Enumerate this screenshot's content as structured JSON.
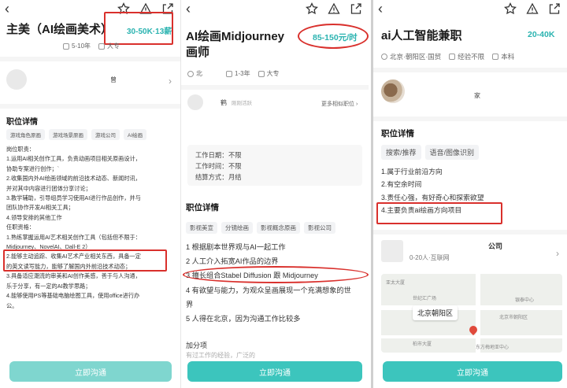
{
  "colors": {
    "accent": "#3cc5bd",
    "salary": "#2ab3b0",
    "annotation": "#d9302c"
  },
  "icons": {
    "back": "chevron-left-icon",
    "star": "star-icon",
    "warning": "warning-icon",
    "share": "share-icon"
  },
  "panel1": {
    "title": "主美（AI绘画美术）",
    "salary": "30-50K·13薪",
    "meta": {
      "exp": "5-10年",
      "edu": "大专"
    },
    "hr_name": "曾",
    "section_title": "职位详情",
    "tags": [
      "游戏角色原画",
      "游戏场景原画",
      "游戏公司",
      "AI绘画"
    ],
    "desc_lines": [
      "岗位职责：",
      "1.运用AI相关创作工具，负责动画项目相关原画设计，",
      "协助专案进行创作；`",
      "2.收集国内外AI绘画领域的前沿技术动态、新闻时讯，",
      "并对其中内容进行团体分享讨论；",
      "3.教学辅助，引导组员学习使用AI进行作品创作，并与",
      "团队协作开发AI相关工具；",
      "4.领导安排的其他工作",
      "任职资格：",
      "1.熟练掌握运用AI艺术相关创作工具（包括但不限于：",
      "Midjourney、NovelAI、Dall-E 2）",
      "2.能够主动追踪、收集AI艺术产业相关东西，具备一定",
      "的英文读写能力，能够了解国内外前沿技术动态；",
      "3.具备适应潮流的审美和AI创作美感，善于与人沟通，",
      "乐于分享，有一定的AI教学思路；",
      "4.能够使用PS等基础电脑绘图工具，使用office进行办",
      "公。"
    ],
    "cta": "立即沟通"
  },
  "panel2": {
    "title_line1": "AI绘画Midjourney",
    "title_line2": "画师",
    "salary": "85-150元/时",
    "meta": {
      "city": "北",
      "exp": "1-3年",
      "edu": "大专"
    },
    "hr_name": "鹤",
    "hr_status": "刚刚活跃",
    "more_link": "更多相似职位 ›",
    "info": [
      {
        "label": "工作日期：",
        "value": "不限"
      },
      {
        "label": "工作时间：",
        "value": "不限"
      },
      {
        "label": "结算方式：",
        "value": "月结"
      }
    ],
    "section_title": "职位详情",
    "tags": [
      "影视美宣",
      "分镜绘画",
      "影视概念原画",
      "影视公司"
    ],
    "desc_lines": [
      "1 根据剧本世界观与AI一起工作",
      "2 人工介入拓宽AI作品的边界",
      "3 擅长组合Stabel Diffusion 跟 Midjourney",
      "4 有欲望与能力，为观众呈画展现一个充满想象的世",
      "界",
      "5 人得在北京，因为沟通工作比较多"
    ],
    "extra_title": "加分项",
    "extra_line": "有过工作的经验，广泛的",
    "cta": "立即沟通"
  },
  "panel3": {
    "title": "ai人工智能兼职",
    "salary": "20-40K",
    "meta": {
      "location": "北京·朝阳区·国贸",
      "exp": "经验不限",
      "edu": "本科"
    },
    "hr_name": "家",
    "section_title": "职位详情",
    "tags": [
      "搜索/推荐",
      "语音/图像识别"
    ],
    "desc_lines": [
      "1.属于行业前沿方向",
      "2.有空余时间",
      "3.责任心强，有好奇心和探索欲望",
      "4.主要负责ai绘画方向项目"
    ],
    "company_name": "公众司",
    "company_name_shown": "公司",
    "company_sub": "0-20人·互联网",
    "map_location": "北京朝阳区",
    "map_labels": [
      "亚太大厦",
      "世纪汇广场",
      "银泰中心",
      "北京市朝阳区",
      "柏市大厦",
      "东方梅地亚中心"
    ],
    "cta": "立即沟通"
  }
}
